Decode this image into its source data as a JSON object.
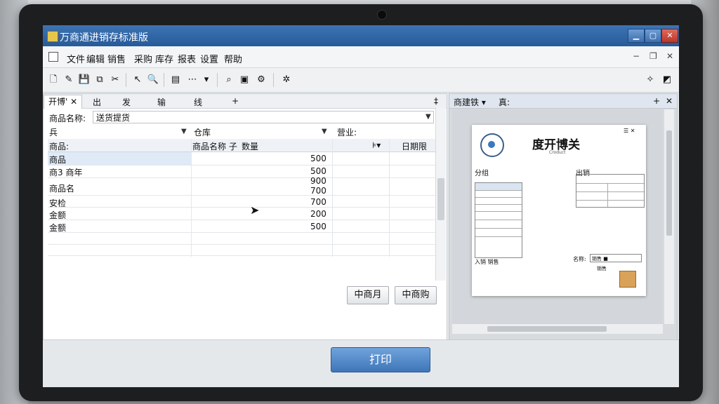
{
  "window": {
    "title": "万商通进销存标准版"
  },
  "menu": {
    "items": [
      "文件",
      "编辑",
      "销售",
      "采购",
      "库存",
      "报表",
      "设置",
      "帮助"
    ]
  },
  "panel_tabs": [
    "开博'",
    "出",
    "发",
    "输",
    "线"
  ],
  "form": {
    "product_name_label": "商品名称:",
    "product_name_value": "送货提货",
    "row2_a": "兵",
    "row2_b": "仓库",
    "row2_c": "营业:"
  },
  "grid": {
    "headers": [
      "商品:",
      "商品名称 子",
      "数量",
      "",
      "日期限 "
    ],
    "rows": [
      {
        "name": "商品",
        "value": "500"
      },
      {
        "name": "商3 商年",
        "value": "500"
      },
      {
        "name": "商品名",
        "value": "900"
      },
      {
        "name": "",
        "value": "700"
      },
      {
        "name": "安检",
        "value": "700"
      },
      {
        "name": "金额",
        "value": "200"
      },
      {
        "name": "金额",
        "value": "500"
      }
    ]
  },
  "buttons": {
    "left": "中商月",
    "right": "中商购",
    "print": "打印"
  },
  "preview": {
    "tab": "商建铁",
    "tab2": "真:",
    "doc_title": "度开博关",
    "doc_subtitle": "Croduct",
    "left_heading": "分组",
    "right_heading": "出销",
    "footer_left": "入销 销售",
    "footer_right": "名称:",
    "footer_box": "销售 ■",
    "small": "销售"
  }
}
